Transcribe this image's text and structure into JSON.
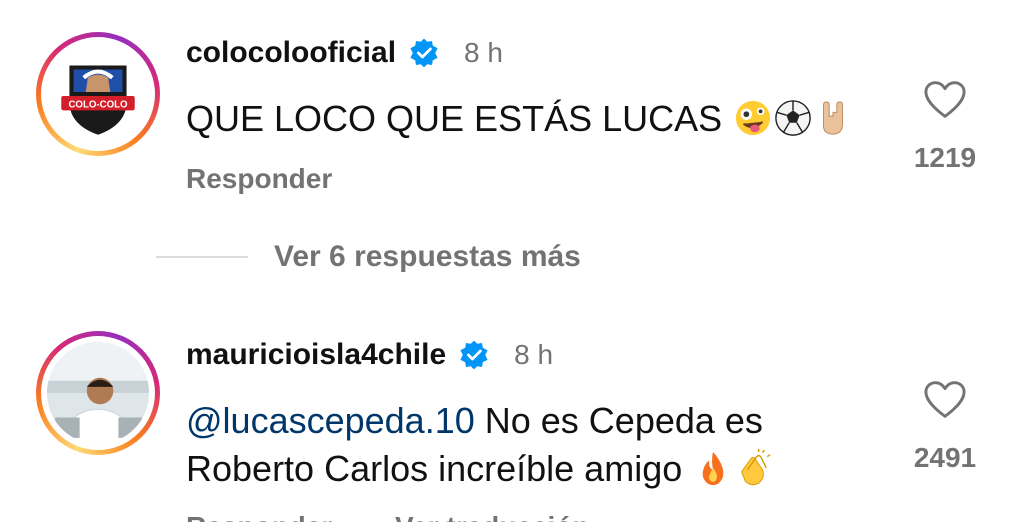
{
  "comments": [
    {
      "username": "colocolooficial",
      "time": "8 h",
      "text": "QUE LOCO QUE ESTÁS LUCAS",
      "emojis": [
        "zany-face",
        "soccer-ball",
        "rock-hand"
      ],
      "avatar_label": "COLO-COLO",
      "likes": "1219",
      "reply_label": "Responder"
    },
    {
      "username": "mauricioisla4chile",
      "time": "8 h",
      "mention": "@lucascepeda.10",
      "text": " No es Cepeda es Roberto Carlos increíble amigo",
      "emojis": [
        "fire",
        "clapping-hands"
      ],
      "likes": "2491",
      "reply_label": "Responder",
      "translate_label": "Ver traducción"
    }
  ],
  "more_replies_label": "Ver 6 respuestas más",
  "colors": {
    "verified": "#0095f6",
    "muted": "#737373",
    "mention": "#00376b"
  }
}
